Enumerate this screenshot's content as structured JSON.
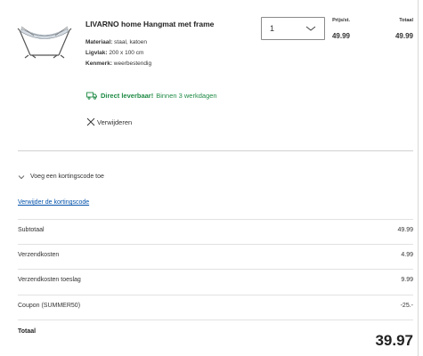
{
  "product": {
    "name": "LIVARNO home Hangmat met frame",
    "specs": [
      {
        "label": "Materiaal:",
        "value": "staal, katoen"
      },
      {
        "label": "Ligvlak:",
        "value": "200 x 100 cm"
      },
      {
        "label": "Kenmerk:",
        "value": "weerbestendig"
      }
    ],
    "quantity": "1",
    "price_per_unit_label": "Prijs/st.",
    "total_label": "Totaal",
    "price_per_unit": "49.99",
    "total": "49.99",
    "delivery_bold": "Direct leverbaar!",
    "delivery_rest": "Binnen 3 werkdagen",
    "remove_label": "Verwijderen"
  },
  "coupon": {
    "toggle_label": "Voeg een kortingscode toe",
    "remove_code_label": "Verwijder de kortingscode"
  },
  "summary": {
    "rows": [
      {
        "label": "Subtotaal",
        "value": "49.99"
      },
      {
        "label": "Verzendkosten",
        "value": "4.99"
      },
      {
        "label": "Verzendkosten toeslag",
        "value": "9.99"
      },
      {
        "label": "Coupon (SUMMER50)",
        "value": "-25.-"
      }
    ],
    "total_label": "Totaal",
    "total_value": "39.97"
  },
  "colors": {
    "delivery_green": "#1e8a44",
    "link_blue": "#0050aa"
  },
  "icons": [
    "hammock-product-image",
    "chevron-down-icon",
    "truck-icon",
    "close-icon",
    "chevron-down-icon"
  ]
}
